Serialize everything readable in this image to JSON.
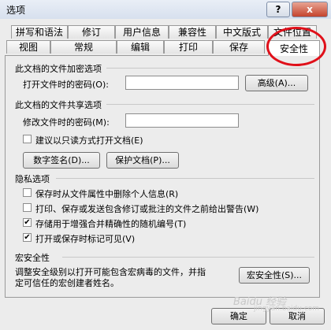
{
  "window": {
    "title": "选项",
    "help_label": "?",
    "close_label": "x"
  },
  "tabs_row1": [
    "拼写和语法",
    "修订",
    "用户信息",
    "兼容性",
    "中文版式",
    "文件位置"
  ],
  "tabs_row2": [
    "视图",
    "常规",
    "编辑",
    "打印",
    "保存",
    "安全性"
  ],
  "active_tab": "安全性",
  "encrypt": {
    "section": "此文档的文件加密选项",
    "password_label": "打开文件时的密码(O):",
    "password_value": "",
    "advanced_button": "高级(A)..."
  },
  "share": {
    "section": "此文档的文件共享选项",
    "modify_label": "修改文件时的密码(M):",
    "modify_value": "",
    "readonly_label": "建议以只读方式打开文档(E)",
    "readonly_checked": false,
    "signature_button": "数字签名(D)...",
    "protect_button": "保护文档(P)..."
  },
  "privacy": {
    "section": "隐私选项",
    "items": [
      {
        "label": "保存时从文件属性中删除个人信息(R)",
        "checked": false
      },
      {
        "label": "打印、保存或发送包含修订或批注的文件之前给出警告(W)",
        "checked": false
      },
      {
        "label": "存储用于增强合并精确性的随机编号(T)",
        "checked": true
      },
      {
        "label": "打开或保存时标记可见(V)",
        "checked": true
      }
    ]
  },
  "macro": {
    "section": "宏安全性",
    "description_line1": "调整安全级别以打开可能包含宏病毒的文件，并指",
    "description_line2": "定可信任的宏创建者姓名。",
    "button": "宏安全性(S)..."
  },
  "footer": {
    "ok_button": "确定",
    "cancel_button": "取消"
  },
  "watermark": {
    "text": "Baidu 经验",
    "sub": "jingyan.baidu.com"
  }
}
